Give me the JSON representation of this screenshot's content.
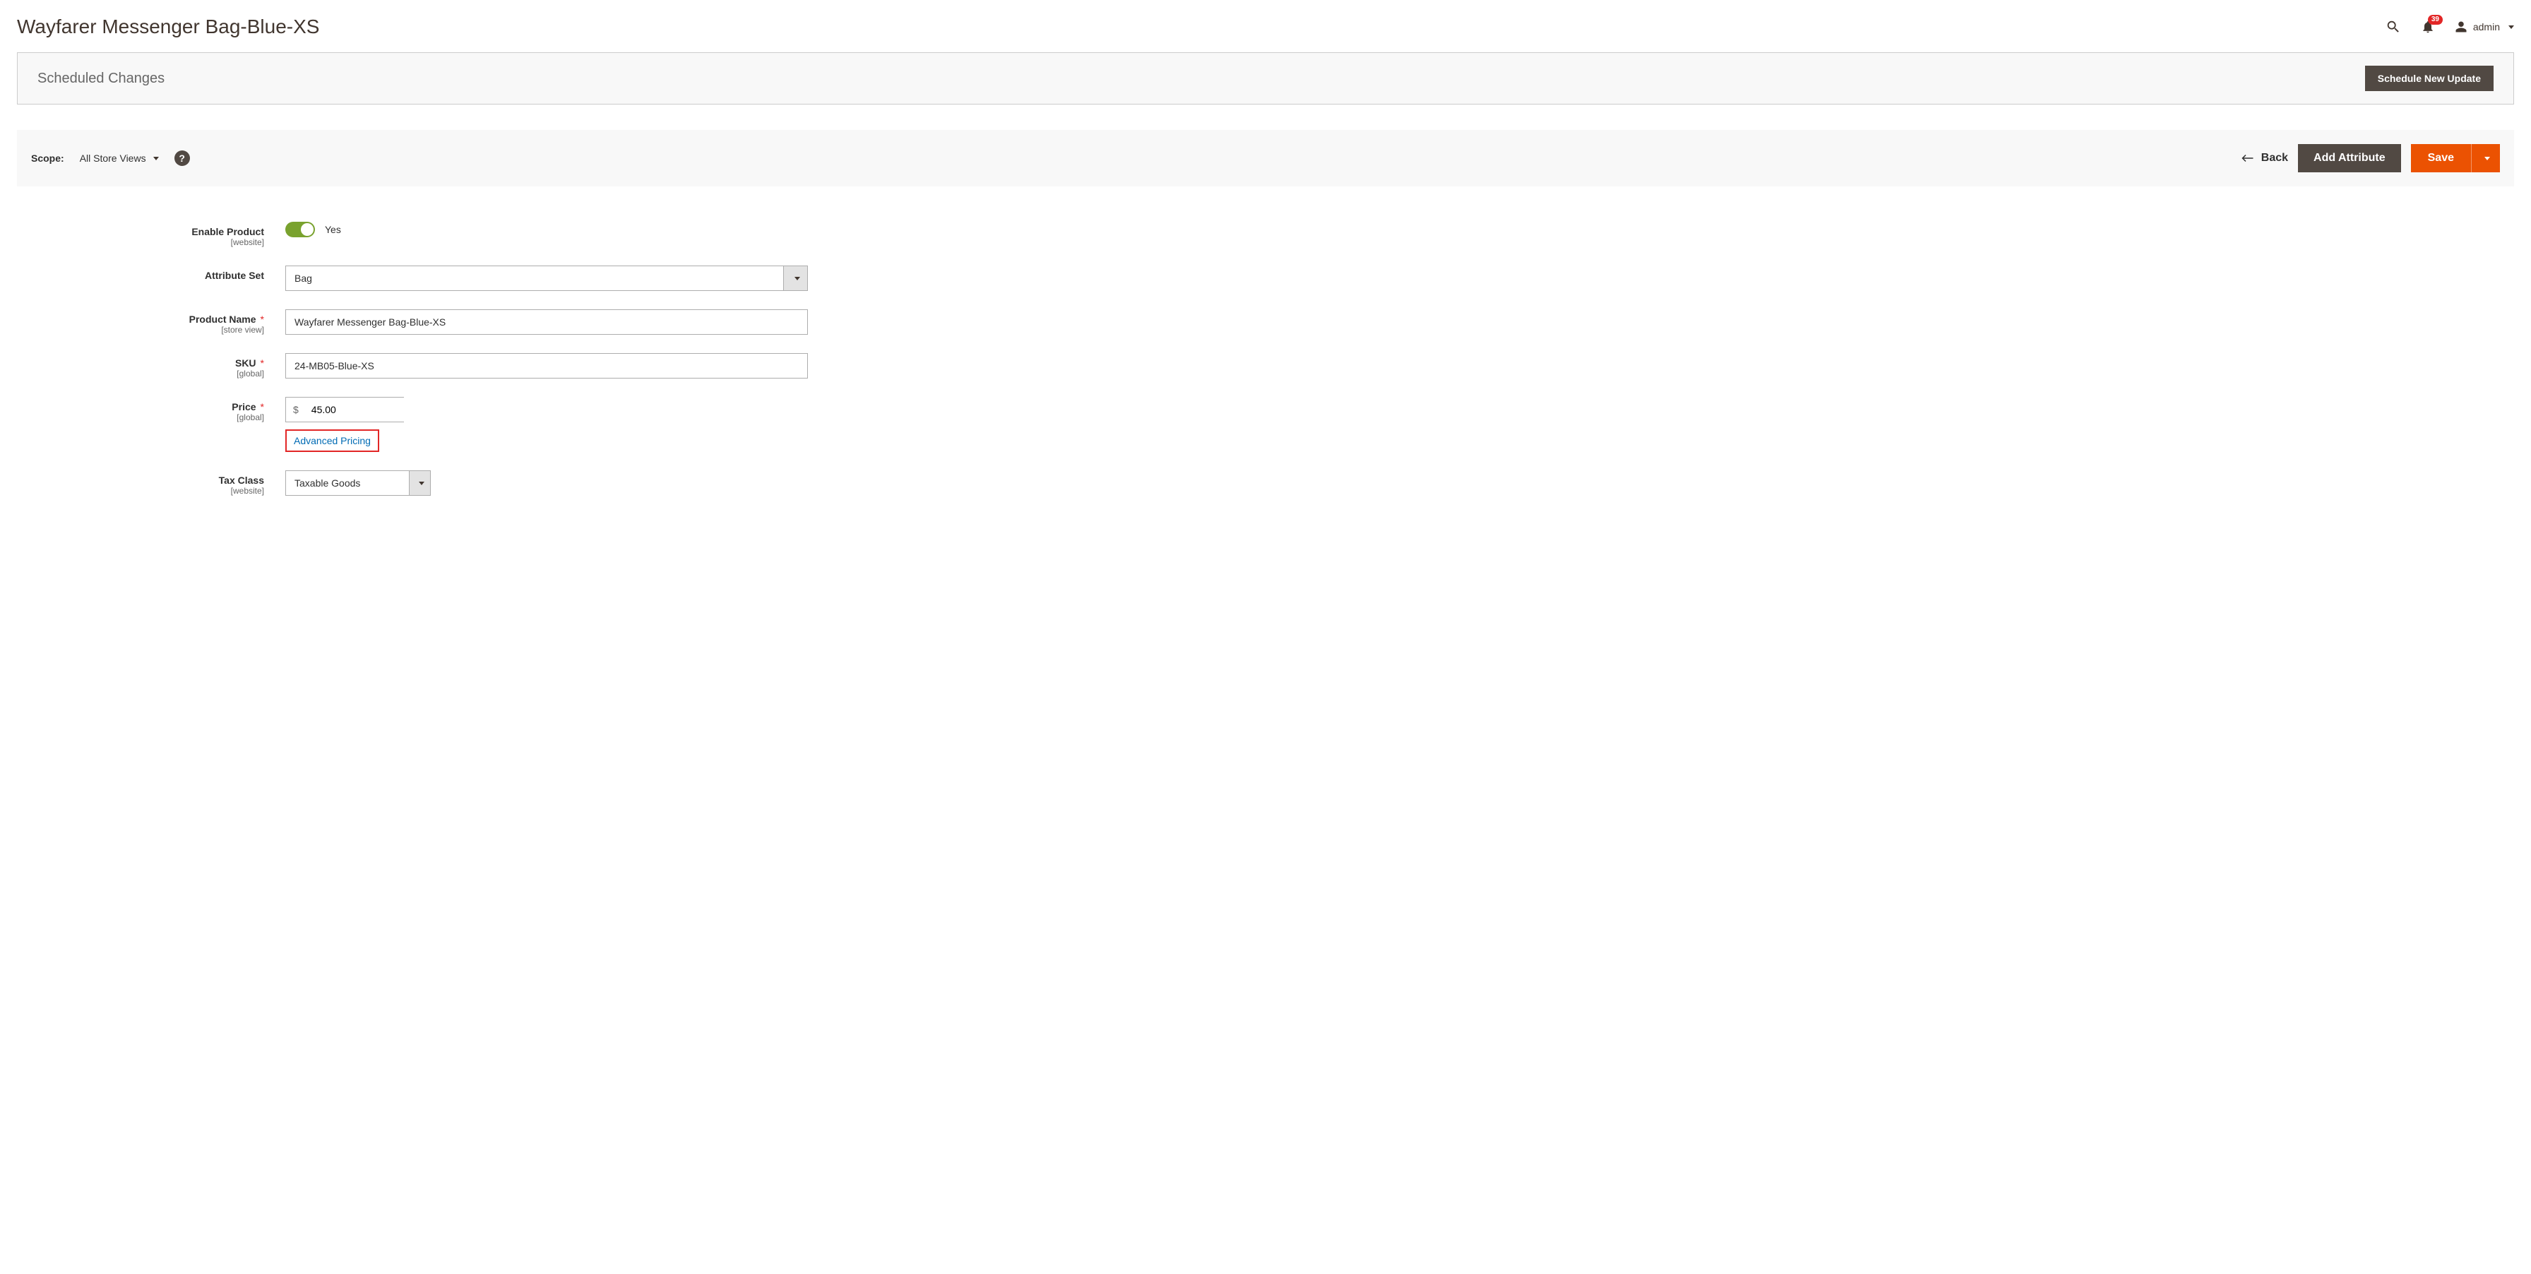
{
  "header": {
    "title": "Wayfarer Messenger Bag-Blue-XS",
    "notification_count": "39",
    "user_name": "admin"
  },
  "scheduled": {
    "title": "Scheduled Changes",
    "new_update_btn": "Schedule New Update"
  },
  "actionbar": {
    "scope_label": "Scope:",
    "scope_value": "All Store Views",
    "back_label": "Back",
    "add_attribute_label": "Add Attribute",
    "save_label": "Save"
  },
  "form": {
    "enable_product": {
      "label": "Enable Product",
      "scope": "[website]",
      "value": "Yes"
    },
    "attribute_set": {
      "label": "Attribute Set",
      "value": "Bag"
    },
    "product_name": {
      "label": "Product Name",
      "scope": "[store view]",
      "value": "Wayfarer Messenger Bag-Blue-XS"
    },
    "sku": {
      "label": "SKU",
      "scope": "[global]",
      "value": "24-MB05-Blue-XS"
    },
    "price": {
      "label": "Price",
      "scope": "[global]",
      "currency": "$",
      "value": "45.00",
      "advanced_label": "Advanced Pricing"
    },
    "tax_class": {
      "label": "Tax Class",
      "scope": "[website]",
      "value": "Taxable Goods"
    }
  }
}
